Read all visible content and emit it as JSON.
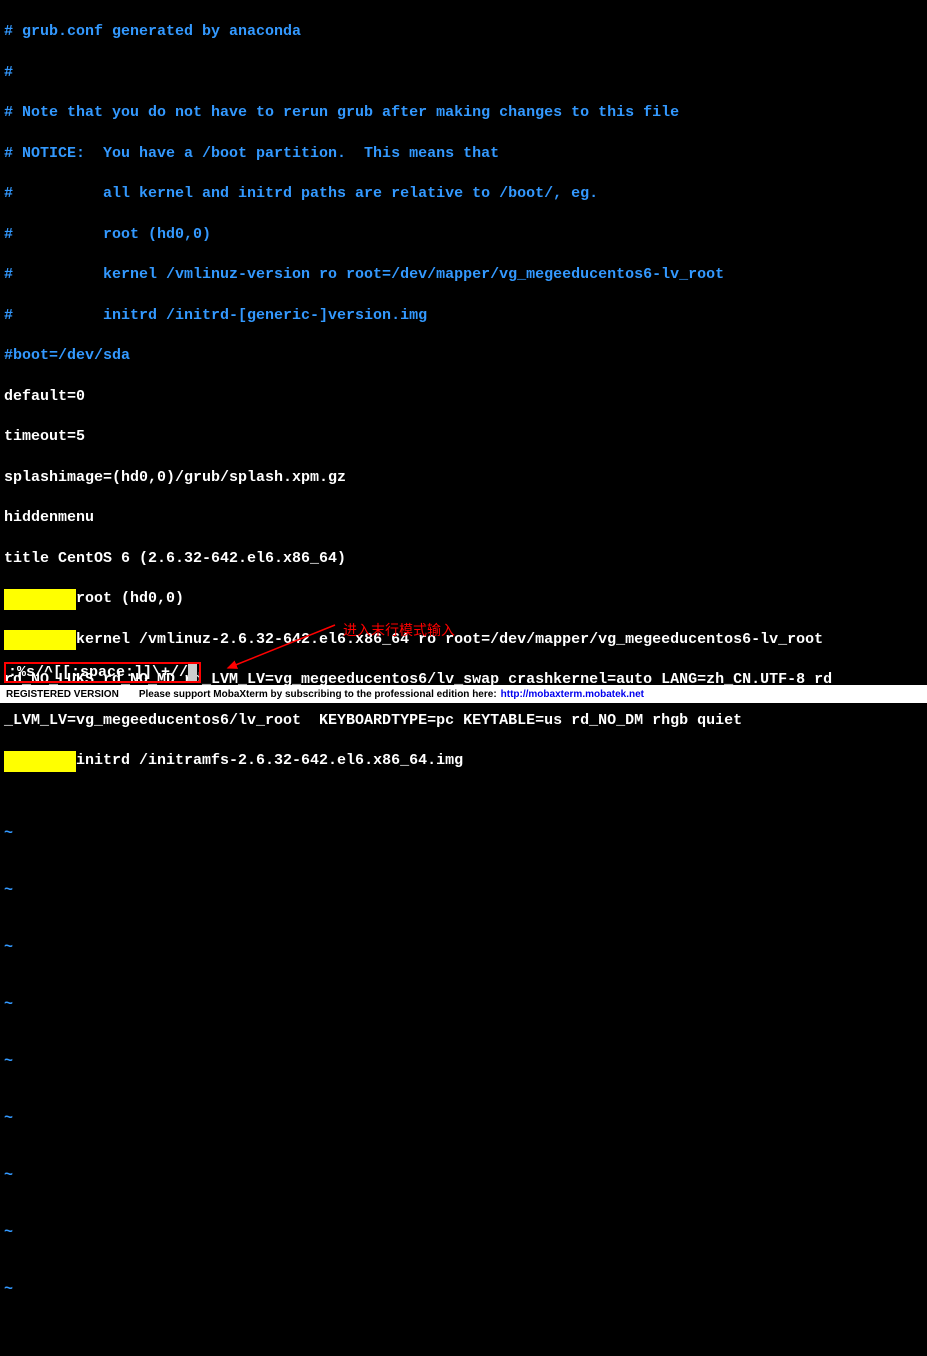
{
  "terminal": {
    "comments": {
      "l1": "# grub.conf generated by anaconda",
      "l2": "#",
      "l3": "# Note that you do not have to rerun grub after making changes to this file",
      "l4": "# NOTICE:  You have a /boot partition.  This means that",
      "l5": "#          all kernel and initrd paths are relative to /boot/, eg.",
      "l6": "#          root (hd0,0)",
      "l7": "#          kernel /vmlinuz-version ro root=/dev/mapper/vg_megeeducentos6-lv_root",
      "l8": "#          initrd /initrd-[generic-]version.img",
      "l9": "#boot=/dev/sda"
    },
    "config": {
      "l10": "default=0",
      "l11": "timeout=5",
      "l12": "splashimage=(hd0,0)/grub/splash.xpm.gz",
      "l13": "hiddenmenu",
      "l14": "title CentOS 6 (2.6.32-642.el6.x86_64)"
    },
    "highlighted_lines": {
      "indent1": "        ",
      "root": "root (hd0,0)",
      "indent2": "        ",
      "kernel_p1": "kernel /vmlinuz-2.6.32-642.el6.x86_64 ro root=/dev/mapper/vg_megeeducentos6-lv_root ",
      "kernel_p2": "rd_NO_LUKS rd_NO_MD rd_LVM_LV=vg_megeeducentos6/lv_swap crashkernel=auto LANG=zh_CN.UTF-8 rd",
      "kernel_p3": "_LVM_LV=vg_megeeducentos6/lv_root  KEYBOARDTYPE=pc KEYTABLE=us rd_NO_DM rhgb quiet",
      "indent3": "        ",
      "initrd": "initrd /initramfs-2.6.32-642.el6.x86_64.img"
    },
    "tilde": "~"
  },
  "command": {
    "text": ":%s/^[[:space:]]\\+//"
  },
  "annotation": {
    "label": "进入末行模式输入"
  },
  "statusbar": {
    "registered": "REGISTERED VERSION",
    "support": "Please support MobaXterm by subscribing to the professional edition here:",
    "link": "http://mobaxterm.mobatek.net"
  }
}
